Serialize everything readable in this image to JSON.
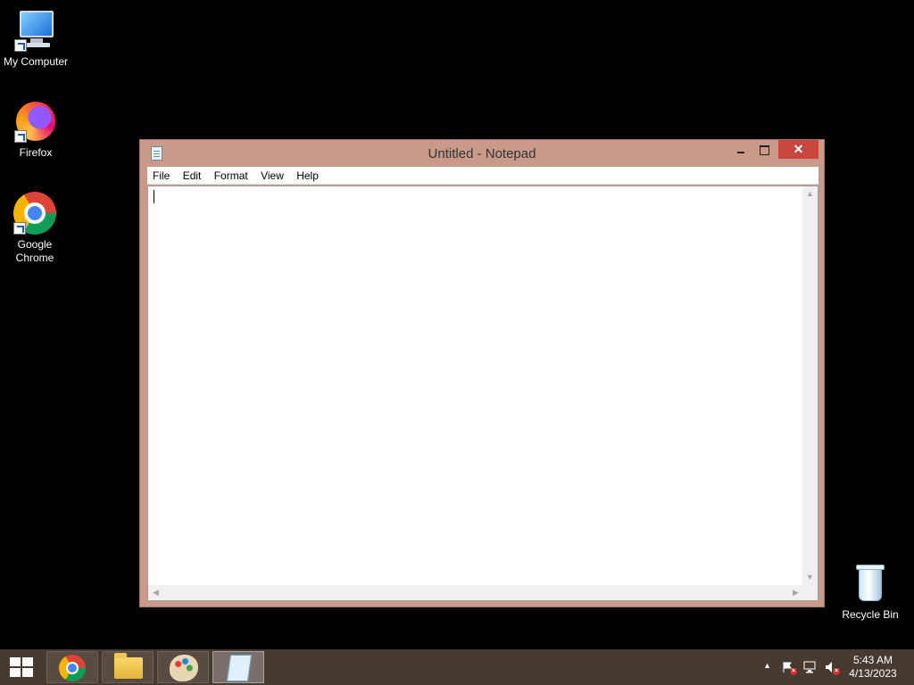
{
  "desktop": {
    "icons": [
      {
        "label": "My Computer"
      },
      {
        "label": "Firefox"
      },
      {
        "label": "Google Chrome"
      },
      {
        "label": "Recycle Bin"
      }
    ]
  },
  "notepad": {
    "title": "Untitled - Notepad",
    "close_glyph": "✕",
    "menu": [
      "File",
      "Edit",
      "Format",
      "View",
      "Help"
    ],
    "text_lines": []
  },
  "taskbar": {
    "apps": [
      {
        "icon": "chrome-icon",
        "active": false
      },
      {
        "icon": "file-explorer-icon",
        "active": false
      },
      {
        "icon": "paint-icon",
        "active": false
      },
      {
        "icon": "notepad-icon",
        "active": true
      }
    ],
    "tray": {
      "chevron": "▲",
      "time": "5:43 AM",
      "date": "4/13/2023"
    }
  }
}
